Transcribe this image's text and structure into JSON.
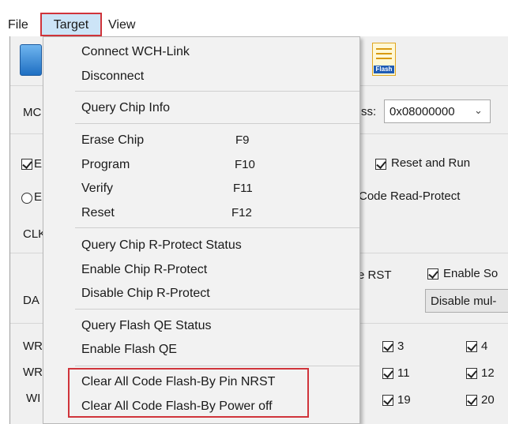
{
  "menubar": {
    "file": "File",
    "target": "Target",
    "view": "View"
  },
  "toolbar": {
    "flash_icon_label": "Flash"
  },
  "window": {
    "mcu_label_partial": "MC",
    "address_label_partial": "ss:",
    "address_value": "0x08000000",
    "reset_and_run": "Reset and Run",
    "code_read_protect": "Code Read-Protect",
    "clk_label_partial": "CLK",
    "rst_label_partial": "e RST",
    "enable_so_partial": "Enable So",
    "da_label_partial": "DA",
    "disable_mul_partial": "Disable mul-",
    "wr_label_partial_1": "WR",
    "wr_label_partial_2": "WR",
    "wr_label_partial_3": "WI",
    "sector_checks": [
      "3",
      "4",
      "11",
      "12",
      "19",
      "20"
    ],
    "check_b_partial": "E",
    "radio_b_partial": "E"
  },
  "menu": {
    "items": {
      "connect": "Connect  WCH-Link",
      "disconnect": "Disconnect",
      "query_chip_info": "Query Chip Info",
      "erase_chip": "Erase Chip",
      "erase_chip_sc": "F9",
      "program": "Program",
      "program_sc": "F10",
      "verify": "Verify",
      "verify_sc": "F11",
      "reset": "Reset",
      "reset_sc": "F12",
      "query_rprotect": "Query Chip R-Protect Status",
      "enable_rprotect": "Enable Chip R-Protect",
      "disable_rprotect": "Disable Chip R-Protect",
      "query_flash_qe": "Query Flash QE Status",
      "enable_flash_qe": "Enable Flash QE",
      "clear_nrst": "Clear All Code Flash-By Pin NRST",
      "clear_power_off": "Clear All Code Flash-By Power off"
    }
  },
  "colors": {
    "highlight_red": "#d0343b",
    "menu_bg": "#f2f2f2",
    "window_bg": "#f0f0f0",
    "target_selected_bg": "#cce4f7"
  }
}
